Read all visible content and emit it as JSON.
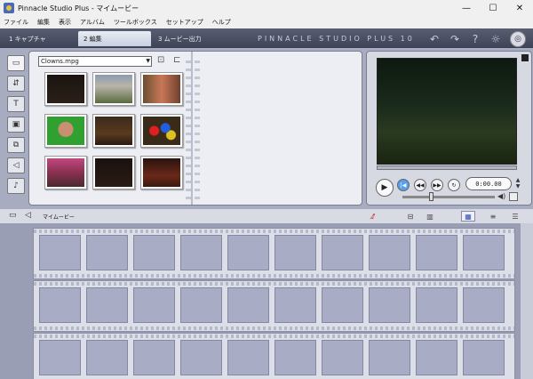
{
  "window": {
    "title": "Pinnacle Studio Plus - マイムービー",
    "minimize": "—",
    "maximize": "☐",
    "close": "✕"
  },
  "menu": [
    "ファイル",
    "編集",
    "表示",
    "アルバム",
    "ツールボックス",
    "セットアップ",
    "ヘルプ"
  ],
  "steps": [
    {
      "label": "1 キャプチャ",
      "active": false
    },
    {
      "label": "2 編集",
      "active": true
    },
    {
      "label": "3 ムービー出力",
      "active": false
    }
  ],
  "brand": "PINNACLE STUDIO PLUS 10",
  "album": {
    "file": "Clowns.mpg"
  },
  "player": {
    "timecode": "0:00.00"
  },
  "timeline": {
    "project_name": "マイムービー"
  },
  "colors": {
    "accent": "#58a0ec",
    "chrome_dark": "#3e4256",
    "storyboard_bg": "#9a9eb4"
  }
}
